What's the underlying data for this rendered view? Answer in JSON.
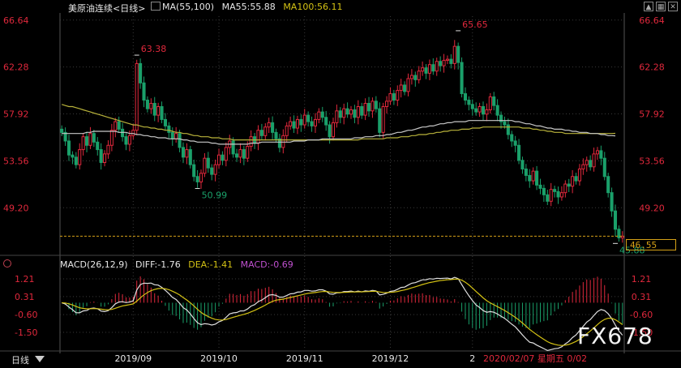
{
  "header": {
    "instrument": "美原油连续<日线>",
    "ma_def": "MA(55,100)",
    "ma55_label": "MA55:55.88",
    "ma100_label": "MA100:56.11"
  },
  "macd_header": {
    "def": "MACD(26,12,9)",
    "diff_label": "DIFF:-1.76",
    "dea_label": "DEA:-1.41",
    "macd_label": "MACD:-0.69"
  },
  "last_price_box": "46.55",
  "period_tab": "日线",
  "watermark": "FX678",
  "colors": {
    "up": "#e0283c",
    "down": "#1aa06a",
    "ma55": "#b9b33b",
    "ma100": "#c8c8c8",
    "diff": "#e0e0e0",
    "dea": "#d4c214",
    "axis_label": "#e0283c",
    "grid": "#3a3a3a",
    "last_price_line": "#d4a017",
    "macd_pos": "#e0283c",
    "macd_neg": "#1aa06a"
  },
  "chart_data": [
    {
      "type": "candlestick",
      "price_ticks": [
        "66.64",
        "62.28",
        "57.92",
        "53.56",
        "49.20"
      ],
      "ylim": [
        45.0,
        67.0
      ],
      "x_labels": [
        "2019/09",
        "2019/10",
        "2019/11",
        "2019/12",
        "2",
        "2020/02/07 星期五 0/02"
      ],
      "annotations": [
        {
          "label": "63.38",
          "idx": 21,
          "kind": "high"
        },
        {
          "label": "50.99",
          "idx": 38,
          "kind": "low"
        },
        {
          "label": "65.65",
          "idx": 111,
          "kind": "high"
        },
        {
          "label": "45.88",
          "idx": 155,
          "kind": "low"
        }
      ],
      "last_price": 46.55,
      "closes": [
        56.2,
        55.4,
        54.1,
        53.9,
        53.2,
        54.6,
        55.8,
        55.0,
        56.1,
        55.3,
        54.6,
        53.4,
        54.2,
        55.0,
        56.4,
        57.2,
        56.5,
        55.8,
        55.1,
        55.9,
        56.4,
        62.6,
        60.8,
        59.2,
        58.4,
        58.9,
        57.8,
        58.6,
        57.4,
        56.8,
        56.2,
        55.6,
        56.1,
        54.8,
        53.9,
        54.6,
        53.2,
        52.1,
        51.6,
        52.4,
        53.8,
        52.9,
        52.3,
        53.2,
        54.1,
        53.6,
        54.8,
        55.4,
        54.2,
        53.9,
        54.6,
        53.8,
        54.9,
        55.8,
        55.2,
        56.4,
        55.9,
        56.7,
        57.1,
        56.2,
        55.6,
        54.8,
        55.9,
        56.8,
        57.2,
        56.6,
        57.4,
        56.9,
        57.8,
        57.2,
        56.8,
        57.4,
        58.1,
        57.6,
        56.9,
        55.8,
        57.1,
        58.2,
        57.6,
        58.4,
        57.9,
        58.3,
        57.6,
        58.6,
        57.8,
        58.9,
        58.2,
        59.1,
        58.4,
        56.2,
        58.6,
        59.1,
        59.8,
        59.2,
        60.1,
        60.6,
        60.0,
        61.2,
        61.5,
        61.1,
        61.9,
        62.2,
        61.7,
        62.5,
        61.9,
        62.8,
        62.4,
        62.9,
        63.0,
        62.6,
        64.2,
        62.7,
        59.8,
        59.2,
        58.8,
        58.4,
        58.1,
        58.6,
        57.9,
        58.3,
        59.5,
        58.7,
        57.8,
        57.2,
        56.9,
        56.0,
        55.4,
        55.0,
        53.6,
        52.8,
        52.2,
        51.7,
        52.6,
        51.3,
        51.0,
        50.4,
        49.8,
        50.9,
        50.7,
        50.2,
        50.6,
        51.4,
        51.2,
        52.1,
        51.7,
        52.8,
        53.2,
        53.6,
        53.0,
        54.2,
        54.5,
        53.8,
        52.1,
        50.6,
        48.9,
        47.2,
        46.4,
        46.55
      ],
      "ma55": [
        56.1,
        56.1,
        56.1,
        56.1,
        56.1,
        56.1,
        56.1,
        56.2,
        56.2,
        56.3,
        56.3,
        56.3,
        56.3,
        56.3,
        56.3,
        56.3,
        56.2,
        56.2,
        56.2,
        56.1,
        56.1,
        56.0,
        56.0,
        55.9,
        55.9,
        55.8,
        55.8,
        55.7,
        55.7,
        55.7,
        55.6,
        55.6,
        55.6,
        55.6,
        55.5,
        55.5,
        55.4,
        55.4,
        55.3,
        55.3,
        55.3,
        55.3,
        55.2,
        55.2,
        55.1,
        55.1,
        55.1,
        55.1,
        55.1,
        55.1,
        55.1,
        55.1,
        55.1,
        55.2,
        55.2,
        55.2,
        55.3,
        55.3,
        55.3,
        55.3,
        55.3,
        55.3,
        55.3,
        55.3,
        55.3,
        55.4,
        55.4,
        55.4,
        55.4,
        55.5,
        55.5,
        55.5,
        55.5,
        55.6,
        55.6,
        55.6,
        55.6,
        55.6,
        55.6,
        55.6,
        55.6,
        55.6,
        55.7,
        55.7,
        55.7,
        55.8,
        55.8,
        55.8,
        55.9,
        55.9,
        55.9,
        56.0,
        56.0,
        56.1,
        56.2,
        56.2,
        56.3,
        56.4,
        56.4,
        56.5,
        56.6,
        56.7,
        56.7,
        56.8,
        56.8,
        56.9,
        57.0,
        57.0,
        57.1,
        57.1,
        57.2,
        57.2,
        57.2,
        57.2,
        57.3,
        57.3,
        57.3,
        57.3,
        57.3,
        57.3,
        57.3,
        57.3,
        57.3,
        57.3,
        57.3,
        57.3,
        57.3,
        57.2,
        57.2,
        57.1,
        57.0,
        57.0,
        56.9,
        56.8,
        56.8,
        56.7,
        56.6,
        56.6,
        56.5,
        56.5,
        56.5,
        56.4,
        56.4,
        56.3,
        56.3,
        56.2,
        56.2,
        56.2,
        56.1,
        56.1,
        56.1,
        56.0,
        56.0,
        55.9,
        55.9,
        55.88
      ],
      "ma100": [
        58.8,
        58.7,
        58.6,
        58.6,
        58.5,
        58.4,
        58.3,
        58.2,
        58.1,
        58.0,
        57.9,
        57.8,
        57.7,
        57.6,
        57.5,
        57.4,
        57.3,
        57.2,
        57.1,
        57.0,
        56.9,
        56.9,
        56.8,
        56.7,
        56.7,
        56.6,
        56.6,
        56.5,
        56.5,
        56.4,
        56.4,
        56.3,
        56.2,
        56.2,
        56.1,
        56.1,
        56.0,
        55.9,
        55.9,
        55.8,
        55.8,
        55.8,
        55.7,
        55.7,
        55.7,
        55.6,
        55.6,
        55.6,
        55.5,
        55.5,
        55.5,
        55.5,
        55.5,
        55.5,
        55.5,
        55.5,
        55.5,
        55.5,
        55.5,
        55.5,
        55.5,
        55.5,
        55.5,
        55.5,
        55.5,
        55.5,
        55.5,
        55.5,
        55.5,
        55.5,
        55.5,
        55.5,
        55.5,
        55.5,
        55.5,
        55.5,
        55.5,
        55.5,
        55.5,
        55.5,
        55.5,
        55.5,
        55.5,
        55.5,
        55.6,
        55.6,
        55.6,
        55.6,
        55.6,
        55.6,
        55.6,
        55.7,
        55.7,
        55.7,
        55.7,
        55.8,
        55.8,
        55.8,
        55.9,
        55.9,
        56.0,
        56.0,
        56.0,
        56.1,
        56.1,
        56.2,
        56.2,
        56.3,
        56.3,
        56.4,
        56.4,
        56.4,
        56.5,
        56.5,
        56.5,
        56.6,
        56.6,
        56.6,
        56.7,
        56.7,
        56.7,
        56.7,
        56.7,
        56.7,
        56.7,
        56.7,
        56.7,
        56.7,
        56.7,
        56.6,
        56.6,
        56.6,
        56.5,
        56.5,
        56.4,
        56.4,
        56.3,
        56.3,
        56.2,
        56.2,
        56.2,
        56.1,
        56.1,
        56.1,
        56.1,
        56.1,
        56.1,
        56.1,
        56.1,
        56.1,
        56.1,
        56.1,
        56.1,
        56.1,
        56.1,
        56.11
      ]
    },
    {
      "type": "macd",
      "ticks": [
        "1.21",
        "0.31",
        "-0.60",
        "-1.50"
      ],
      "ylim": [
        -2.4,
        1.7
      ],
      "diff_last": -1.76,
      "dea_last": -1.41,
      "macd_last": -0.69
    }
  ]
}
